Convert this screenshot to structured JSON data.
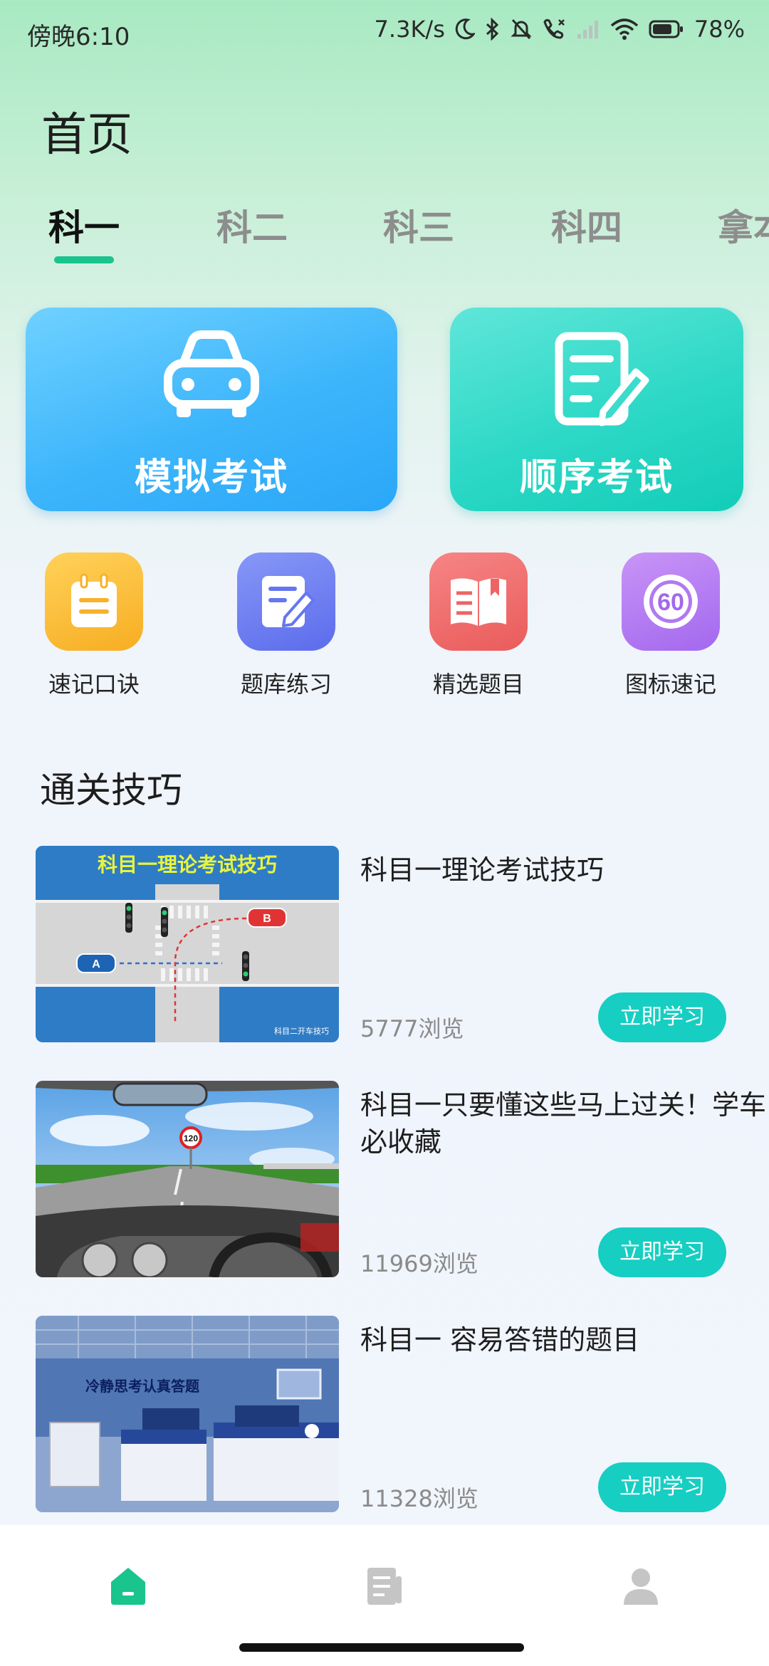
{
  "status_bar": {
    "time": "傍晚6:10",
    "net_speed": "7.3K/s",
    "battery": "78%"
  },
  "page": {
    "title": "首页"
  },
  "tabs": [
    {
      "label": "科一",
      "active": true
    },
    {
      "label": "科二",
      "active": false
    },
    {
      "label": "科三",
      "active": false
    },
    {
      "label": "科四",
      "active": false
    },
    {
      "label": "拿本",
      "active": false
    }
  ],
  "cards": {
    "mock_exam": {
      "label": "模拟考试",
      "icon": "car-icon"
    },
    "order_exam": {
      "label": "顺序考试",
      "icon": "edit-document-icon"
    }
  },
  "shortcuts": [
    {
      "label": "速记口诀",
      "icon": "notepad-icon",
      "color": "#f9b733"
    },
    {
      "label": "题库练习",
      "icon": "pen-document-icon",
      "color": "#6b7bf2"
    },
    {
      "label": "精选题目",
      "icon": "open-book-icon",
      "color": "#ef6b6b"
    },
    {
      "label": "图标速记",
      "icon": "speed-limit-60-icon",
      "color": "#b97cf3"
    }
  ],
  "shortcut_speed_text": "60",
  "section": {
    "title": "通关技巧"
  },
  "articles": [
    {
      "title": "科目一理论考试技巧",
      "views": "5777浏览",
      "button": "立即学习",
      "thumb_text": "科目一理论考试技巧",
      "thumb_badge": "科目二开车技巧"
    },
    {
      "title": "科目一只要懂这些马上过关！学车必收藏",
      "views": "11969浏览",
      "button": "立即学习",
      "thumb_sign": "120"
    },
    {
      "title": "科目一 容易答错的题目",
      "views": "11328浏览",
      "button": "立即学习",
      "thumb_banner": "冷静思考认真答题"
    }
  ],
  "bottom_nav": [
    {
      "name": "home",
      "icon": "home-icon",
      "active": true
    },
    {
      "name": "articles",
      "icon": "document-icon",
      "active": false
    },
    {
      "name": "profile",
      "icon": "user-icon",
      "active": false
    }
  ],
  "colors": {
    "accent": "#19c48d",
    "button": "#16cec2"
  }
}
